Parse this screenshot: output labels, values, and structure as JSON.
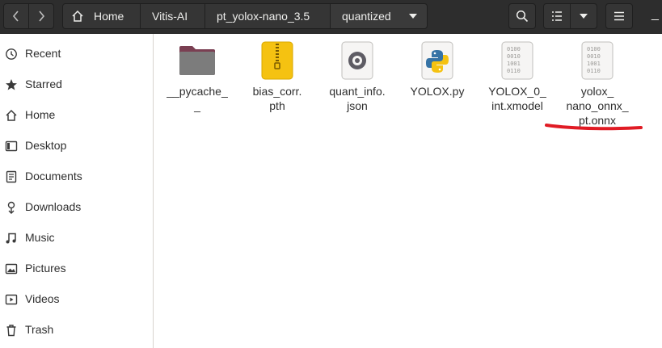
{
  "toolbar": {
    "back_icon": "chevron-left-icon",
    "forward_icon": "chevron-right-icon",
    "breadcrumb": [
      "Home",
      "Vitis-AI",
      "pt_yolox-nano_3.5",
      "quantized"
    ],
    "minimize_label": "_"
  },
  "sidebar": {
    "items": [
      {
        "label": "Recent",
        "icon": "clock-icon"
      },
      {
        "label": "Starred",
        "icon": "star-icon"
      },
      {
        "label": "Home",
        "icon": "home-icon"
      },
      {
        "label": "Desktop",
        "icon": "desktop-icon"
      },
      {
        "label": "Documents",
        "icon": "document-icon"
      },
      {
        "label": "Downloads",
        "icon": "download-icon"
      },
      {
        "label": "Music",
        "icon": "music-icon"
      },
      {
        "label": "Pictures",
        "icon": "picture-icon"
      },
      {
        "label": "Videos",
        "icon": "video-icon"
      },
      {
        "label": "Trash",
        "icon": "trash-icon"
      }
    ]
  },
  "files": [
    {
      "name": "__pycache_\n_",
      "type": "folder"
    },
    {
      "name": "bias_corr.\npth",
      "type": "archive"
    },
    {
      "name": "quant_info.\njson",
      "type": "json"
    },
    {
      "name": "YOLOX.py",
      "type": "python"
    },
    {
      "name": "YOLOX_0_\nint.xmodel",
      "type": "binary"
    },
    {
      "name": "yolox_\nnano_onnx_\npt.onnx",
      "type": "binary"
    }
  ],
  "colors": {
    "headerbar": "#2d2d2d",
    "annotation": "#e01b24"
  }
}
